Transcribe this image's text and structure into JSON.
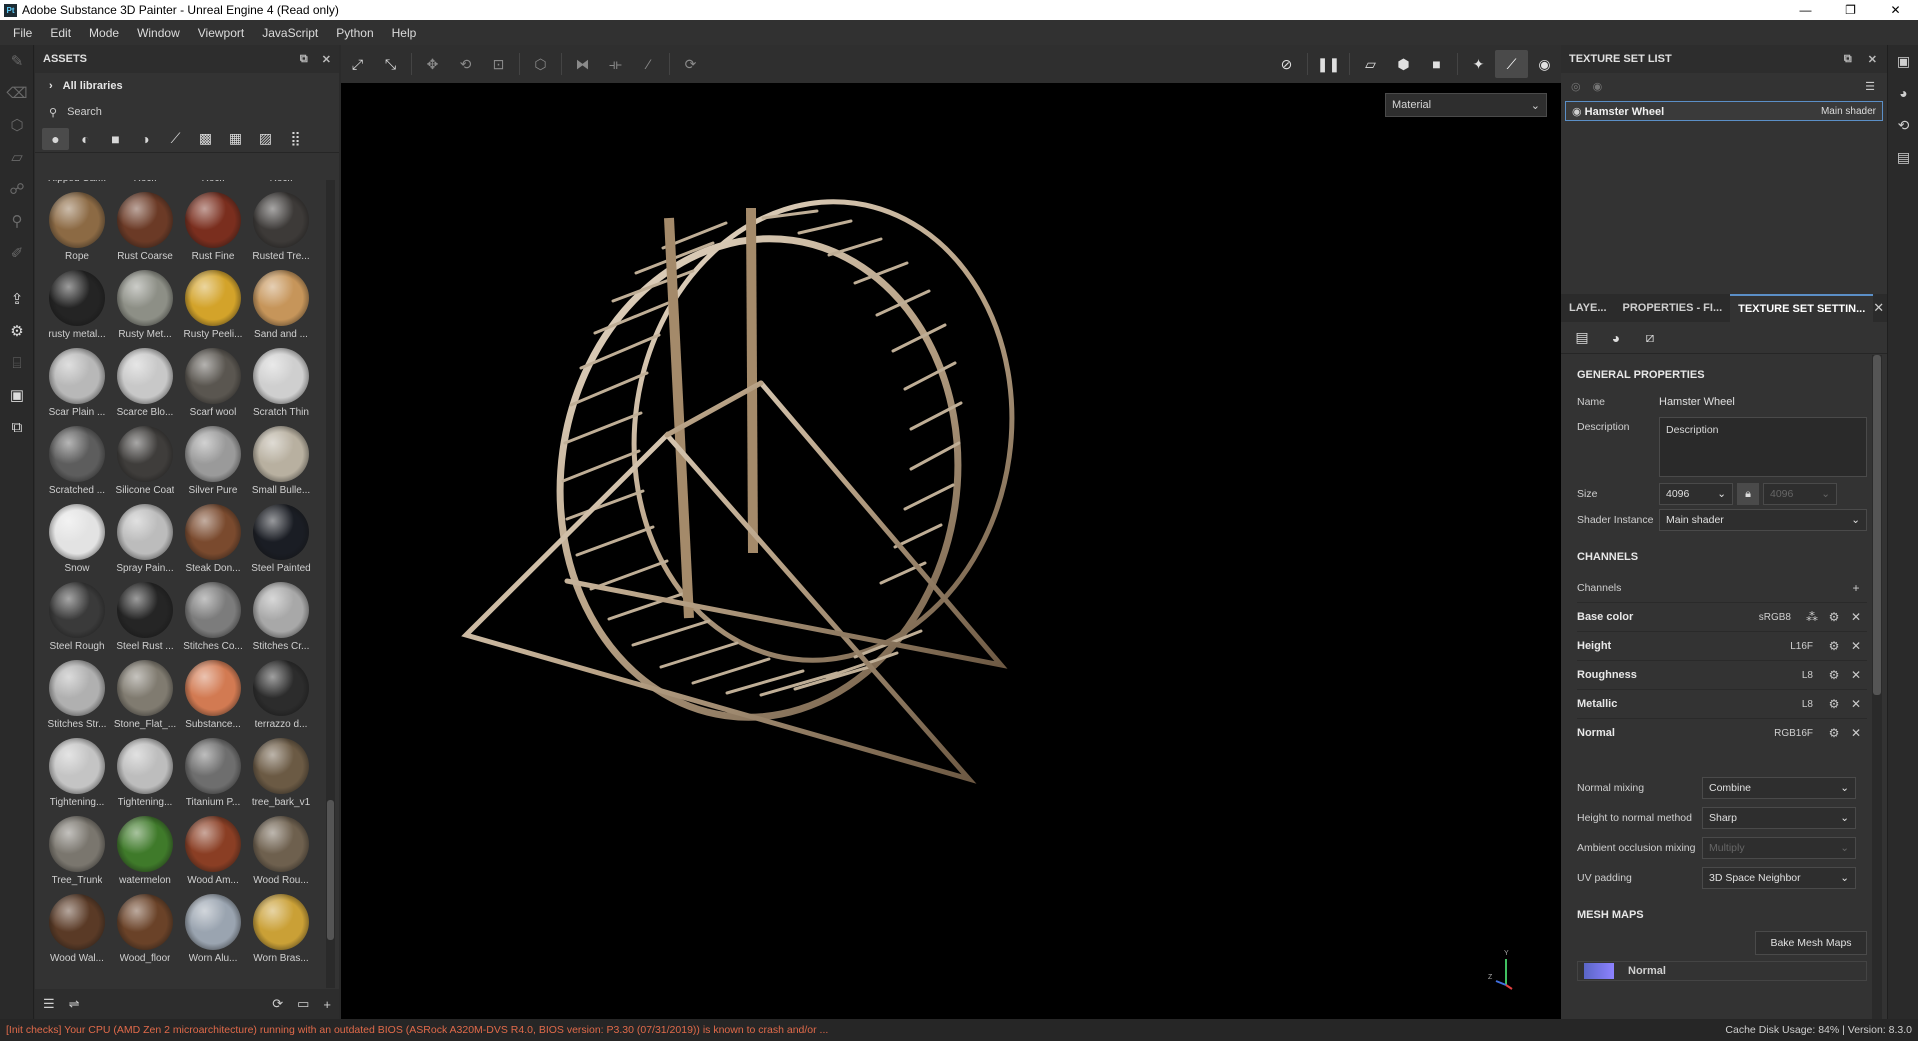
{
  "window": {
    "title": "Adobe Substance 3D Painter - Unreal Engine 4 (Read only)",
    "app_icon_text": "Pt",
    "minimize": "—",
    "maximize": "❐",
    "close": "✕"
  },
  "menu": [
    "File",
    "Edit",
    "Mode",
    "Window",
    "Viewport",
    "JavaScript",
    "Python",
    "Help"
  ],
  "assets": {
    "title": "ASSETS",
    "libraries_label": "All libraries",
    "search_placeholder": "Search",
    "items": [
      {
        "label": "Ripped Car...",
        "color": "#8a6a4a"
      },
      {
        "label": "Rock",
        "color": "#6e6a66"
      },
      {
        "label": "Rock",
        "color": "#7a7670"
      },
      {
        "label": "Rock",
        "color": "#8b867e"
      },
      {
        "label": "Rope",
        "color": "#8c6a44"
      },
      {
        "label": "Rust Coarse",
        "color": "#6b3a26"
      },
      {
        "label": "Rust Fine",
        "color": "#7a2e1e"
      },
      {
        "label": "Rusted Tre...",
        "color": "#3d3a38"
      },
      {
        "label": "rusty metal...",
        "color": "#242424"
      },
      {
        "label": "Rusty Met...",
        "color": "#8d8f86"
      },
      {
        "label": "Rusty Peeli...",
        "color": "#d3a32a"
      },
      {
        "label": "Sand and ...",
        "color": "#c6955a"
      },
      {
        "label": "Scar Plain ...",
        "color": "#b8b8b8"
      },
      {
        "label": "Scarce Blo...",
        "color": "#c8c8c8"
      },
      {
        "label": "Scarf wool",
        "color": "#5a5650"
      },
      {
        "label": "Scratch Thin",
        "color": "#cfcfcf"
      },
      {
        "label": "Scratched ...",
        "color": "#5d5d5d"
      },
      {
        "label": "Silicone Coat",
        "color": "#3f3d3b"
      },
      {
        "label": "Silver Pure",
        "color": "#9a9a9a"
      },
      {
        "label": "Small Bulle...",
        "color": "#b8b0a0"
      },
      {
        "label": "Snow",
        "color": "#e3e3e3"
      },
      {
        "label": "Spray Pain...",
        "color": "#bcbcbc"
      },
      {
        "label": "Steak Don...",
        "color": "#7a4a2e"
      },
      {
        "label": "Steel Painted",
        "color": "#1a1d24"
      },
      {
        "label": "Steel Rough",
        "color": "#3a3a3a"
      },
      {
        "label": "Steel Rust ...",
        "color": "#252525"
      },
      {
        "label": "Stitches Co...",
        "color": "#7c7c7c"
      },
      {
        "label": "Stitches Cr...",
        "color": "#a8a8a8"
      },
      {
        "label": "Stitches Str...",
        "color": "#b0b0b0"
      },
      {
        "label": "Stone_Flat_...",
        "color": "#807b70"
      },
      {
        "label": "Substance...",
        "color": "#d27a52"
      },
      {
        "label": "terrazzo d...",
        "color": "#2c2c2c"
      },
      {
        "label": "Tightening...",
        "color": "#c4c4c4"
      },
      {
        "label": "Tightening...",
        "color": "#bdbdbd"
      },
      {
        "label": "Titanium P...",
        "color": "#6e6e6e"
      },
      {
        "label": "tree_bark_v1",
        "color": "#6b5a44"
      },
      {
        "label": "Tree_Trunk",
        "color": "#7a766e"
      },
      {
        "label": "watermelon",
        "color": "#3f7a2a"
      },
      {
        "label": "Wood Am...",
        "color": "#8a3e24"
      },
      {
        "label": "Wood Rou...",
        "color": "#6e604e"
      },
      {
        "label": "Wood Wal...",
        "color": "#5a3a26"
      },
      {
        "label": "Wood_floor",
        "color": "#6a4228"
      },
      {
        "label": "Worn Alu...",
        "color": "#9aa4b0"
      },
      {
        "label": "Worn Bras...",
        "color": "#caa036"
      }
    ]
  },
  "viewport": {
    "material_mode": "Material"
  },
  "texture_set_list": {
    "title": "TEXTURE SET LIST",
    "item_name": "Hamster Wheel",
    "item_shader": "Main shader"
  },
  "tabs": {
    "layers": "LAYE...",
    "properties": "PROPERTIES - FI...",
    "texture_set_settings": "TEXTURE SET SETTIN..."
  },
  "settings": {
    "general_title": "GENERAL PROPERTIES",
    "name_label": "Name",
    "name_value": "Hamster Wheel",
    "description_label": "Description",
    "description_value": "Description",
    "size_label": "Size",
    "size_value": "4096",
    "size_value_2": "4096",
    "shader_instance_label": "Shader Instance",
    "shader_instance_value": "Main shader",
    "channels_title": "CHANNELS",
    "channels_label": "Channels",
    "channels": [
      {
        "name": "Base color",
        "format": "sRGB8"
      },
      {
        "name": "Height",
        "format": "L16F"
      },
      {
        "name": "Roughness",
        "format": "L8"
      },
      {
        "name": "Metallic",
        "format": "L8"
      },
      {
        "name": "Normal",
        "format": "RGB16F"
      }
    ],
    "normal_mixing_label": "Normal mixing",
    "normal_mixing_value": "Combine",
    "height_to_normal_label": "Height to normal method",
    "height_to_normal_value": "Sharp",
    "ao_mixing_label": "Ambient occlusion mixing",
    "ao_mixing_value": "Multiply",
    "uv_padding_label": "UV padding",
    "uv_padding_value": "3D Space Neighbor",
    "mesh_maps_title": "MESH MAPS",
    "bake_label": "Bake Mesh Maps",
    "mesh_map_first": "Normal"
  },
  "status": {
    "error": "[Init checks] Your CPU (AMD Zen 2 microarchitecture) running with an outdated BIOS (ASRock A320M-DVS R4.0, BIOS version: P3.30 (07/31/2019)) is known to crash and/or ...",
    "cache": "Cache Disk Usage:    84% | Version: 8.3.0"
  },
  "colors": {
    "accent": "#5b8fc7",
    "error_text": "#e06a4a",
    "metal": "#c8b49a"
  }
}
